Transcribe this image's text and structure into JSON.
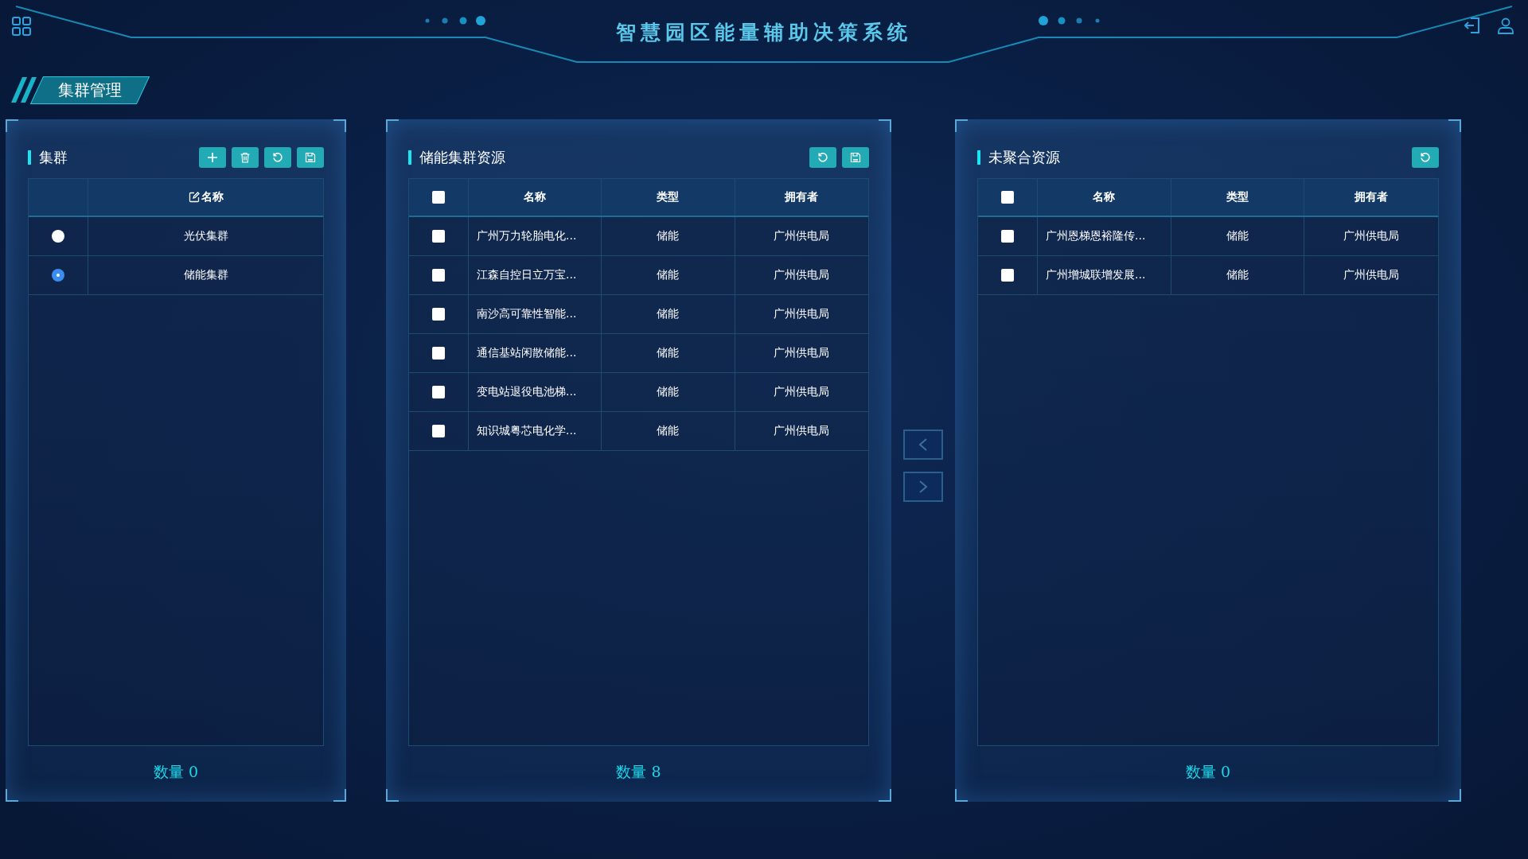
{
  "header": {
    "title": "智慧园区能量辅助决策系统"
  },
  "section": {
    "title": "集群管理"
  },
  "cluster_panel": {
    "title": "集群",
    "tools": [
      {
        "kind": "add"
      },
      {
        "kind": "delete"
      },
      {
        "kind": "refresh"
      },
      {
        "kind": "save"
      }
    ],
    "columns": [
      {
        "label": "名称"
      }
    ],
    "rows": [
      {
        "name": "光伏集群",
        "selected": false
      },
      {
        "name": "储能集群",
        "selected": true
      }
    ],
    "count": "数量 0"
  },
  "resource_panel": {
    "title": "储能集群资源",
    "tools": [
      {
        "kind": "refresh"
      },
      {
        "kind": "save"
      }
    ],
    "select_all_checked": false,
    "columns": [
      {
        "label": "名称"
      },
      {
        "label": "类型"
      },
      {
        "label": "拥有者"
      }
    ],
    "rows": [
      {
        "name": "广州万力轮胎电化...",
        "type": "储能",
        "owner": "广州供电局",
        "checked": false
      },
      {
        "name": "江森自控日立万宝...",
        "type": "储能",
        "owner": "广州供电局",
        "checked": false
      },
      {
        "name": "南沙高可靠性智能...",
        "type": "储能",
        "owner": "广州供电局",
        "checked": false
      },
      {
        "name": "通信基站闲散储能...",
        "type": "储能",
        "owner": "广州供电局",
        "checked": false
      },
      {
        "name": "变电站退役电池梯...",
        "type": "储能",
        "owner": "广州供电局",
        "checked": false
      },
      {
        "name": "知识城粤芯电化学...",
        "type": "储能",
        "owner": "广州供电局",
        "checked": false
      }
    ],
    "count": "数量 8"
  },
  "unaggregated_panel": {
    "title": "未聚合资源",
    "tools": [
      {
        "kind": "refresh"
      }
    ],
    "select_all_checked": false,
    "columns": [
      {
        "label": "名称"
      },
      {
        "label": "类型"
      },
      {
        "label": "拥有者"
      }
    ],
    "rows": [
      {
        "name": "广州恩梯恩裕隆传...",
        "type": "储能",
        "owner": "广州供电局",
        "checked": false
      },
      {
        "name": "广州增城联增发展...",
        "type": "储能",
        "owner": "广州供电局",
        "checked": false
      }
    ],
    "count": "数量 0"
  }
}
